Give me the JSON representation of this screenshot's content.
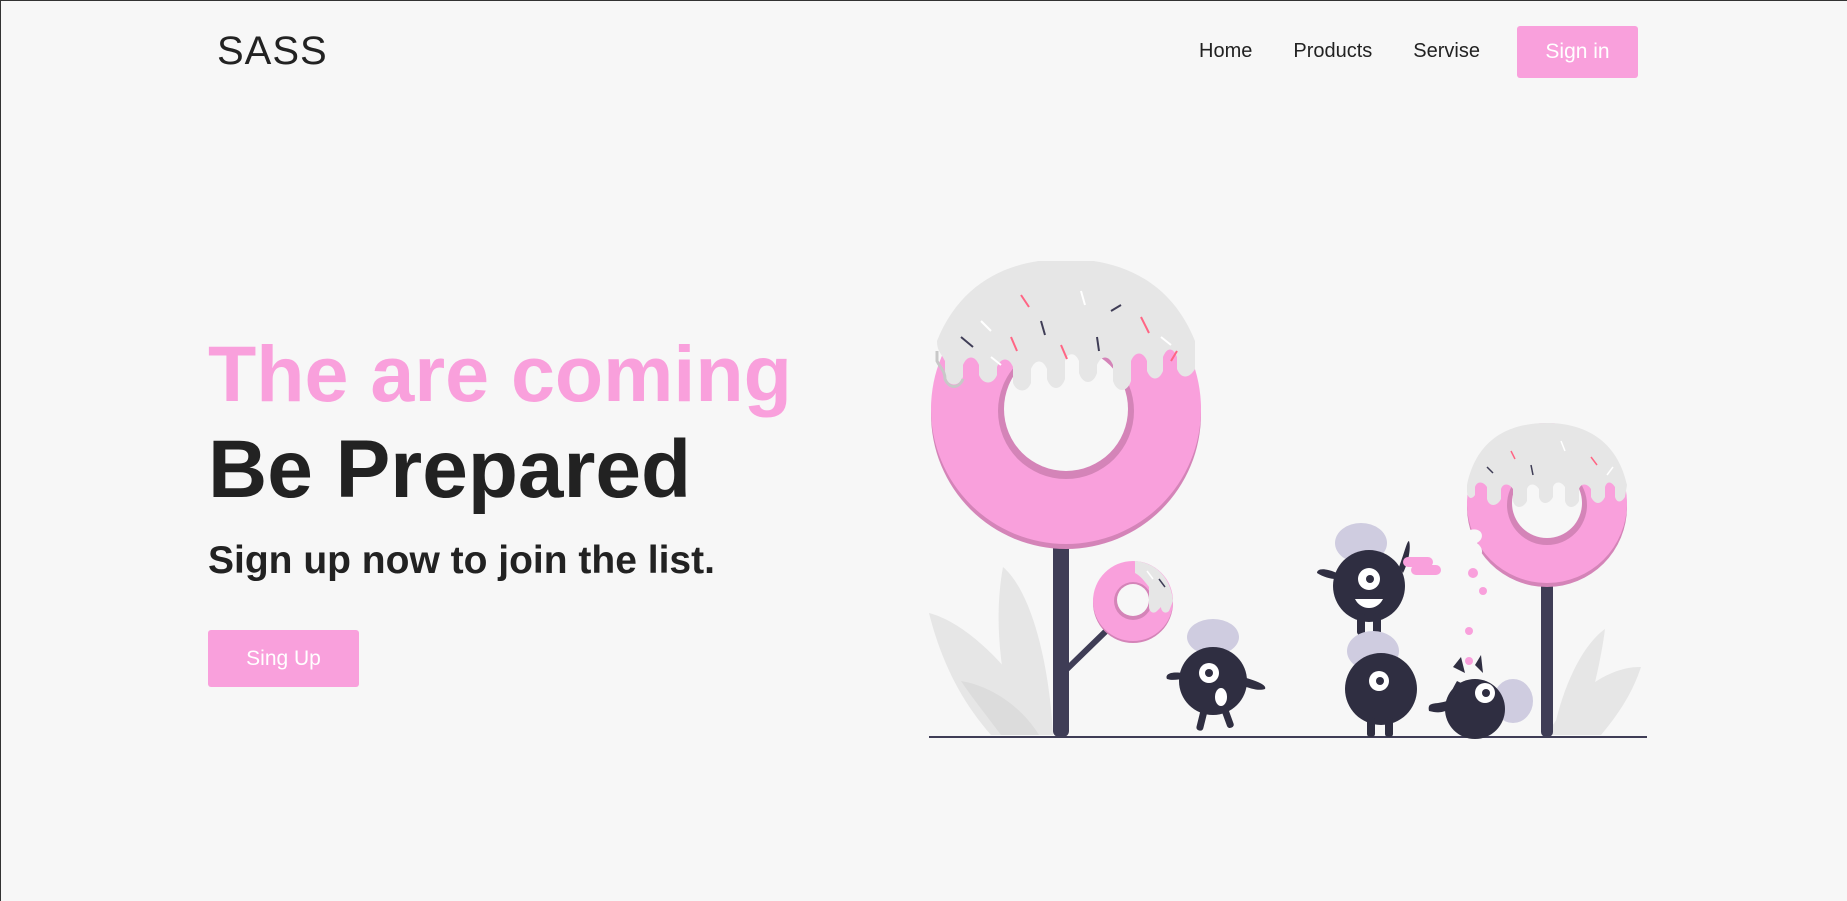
{
  "header": {
    "logo": "SASS",
    "nav": [
      {
        "label": "Home"
      },
      {
        "label": "Products"
      },
      {
        "label": "Servise"
      }
    ],
    "sign_in_label": "Sign in"
  },
  "hero": {
    "title_pink": "The are coming",
    "title_dark": "Be Prepared",
    "subtitle": "Sign up now to join the list.",
    "cta_label": "Sing Up"
  },
  "illustration": {
    "subject": "donut-trees-and-monsters",
    "colors": {
      "accent_pink": "#f9a0dc",
      "pink_shadow": "#d484b8",
      "icing": "#e6e6e6",
      "dark": "#2f2e41",
      "trunk": "#3f3d56",
      "hat": "#cfcce0",
      "leaf": "#e6e6e6"
    }
  }
}
